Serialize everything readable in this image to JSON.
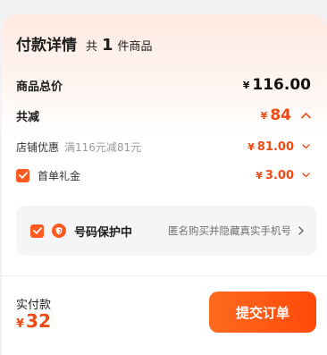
{
  "header": {
    "title": "付款详情",
    "count_prefix": "共",
    "count": "1",
    "count_suffix": "件商品"
  },
  "total": {
    "label": "商品总价",
    "currency": "¥",
    "amount": "116.00"
  },
  "discount": {
    "label": "共减",
    "currency": "¥",
    "amount": "84"
  },
  "shop_coupon": {
    "label": "店铺优惠",
    "desc": "满116元减81元",
    "currency": "¥",
    "amount": "81.00"
  },
  "first_gift": {
    "label": "首单礼金",
    "currency": "¥",
    "amount": "3.00",
    "checked": true
  },
  "privacy": {
    "title": "号码保护中",
    "desc": "匿名购买并隐藏真实手机号",
    "checked": true
  },
  "footer": {
    "pay_label": "实付款",
    "currency": "¥",
    "amount": "32",
    "submit_label": "提交订单"
  },
  "colors": {
    "accent": "#ff5a1f",
    "price": "#f04a15"
  }
}
